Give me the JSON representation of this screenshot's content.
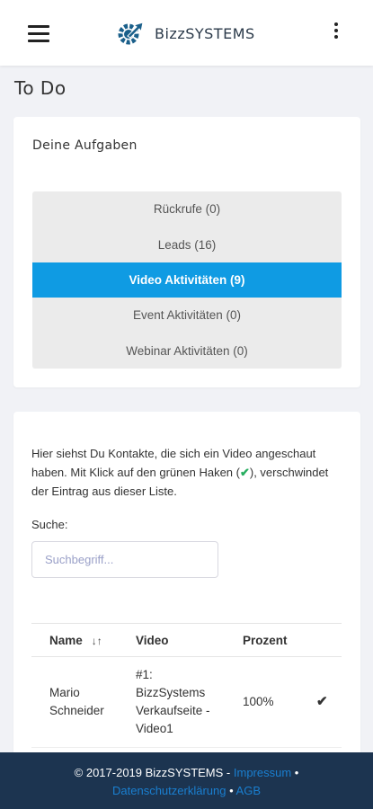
{
  "header": {
    "brand": "BizzSYSTEMS",
    "menu_icon": "hamburger-menu-icon",
    "more_icon": "kebab-menu-icon",
    "logo_icon": "gear-arrow-logo-icon",
    "brand_color": "#1a5f8a"
  },
  "page": {
    "title": "To Do"
  },
  "tasks": {
    "heading": "Deine Aufgaben",
    "items": [
      {
        "label": "Rückrufe (0)",
        "active": false
      },
      {
        "label": "Leads (16)",
        "active": false
      },
      {
        "label": "Video Aktivitäten (9)",
        "active": true
      },
      {
        "label": "Event Aktivitäten (0)",
        "active": false
      },
      {
        "label": "Webinar Aktivitäten (0)",
        "active": false
      }
    ],
    "active_color": "#0f9be3"
  },
  "contacts": {
    "info_before": "Hier siehst Du Kontakte, die sich ein Video angeschaut haben. Mit Klick auf den grünen Haken (",
    "info_check": "✔",
    "info_after": "), verschwindet der Eintrag aus dieser Liste.",
    "search_label": "Suche:",
    "search_placeholder": "Suchbegriff...",
    "search_value": "",
    "columns": {
      "name": "Name",
      "video": "Video",
      "percent": "Prozent"
    },
    "sort_icon": "sort-ascending-icon",
    "rows": [
      {
        "name": "Mario Schneider",
        "video": "#1: BizzSystems Verkaufseite - Video1",
        "percent": "100%",
        "check": "✔"
      }
    ],
    "check_color": "#27ae60"
  },
  "footer": {
    "copyright": "© 2017-2019 BizzSYSTEMS",
    "sep1": " - ",
    "link_impressum": "Impressum",
    "sep2": " • ",
    "link_datenschutz": "Datenschutzerklärung",
    "sep3": " • ",
    "link_agb": "AGB",
    "background": "#1c3450",
    "link_color": "#1a7fd0"
  }
}
